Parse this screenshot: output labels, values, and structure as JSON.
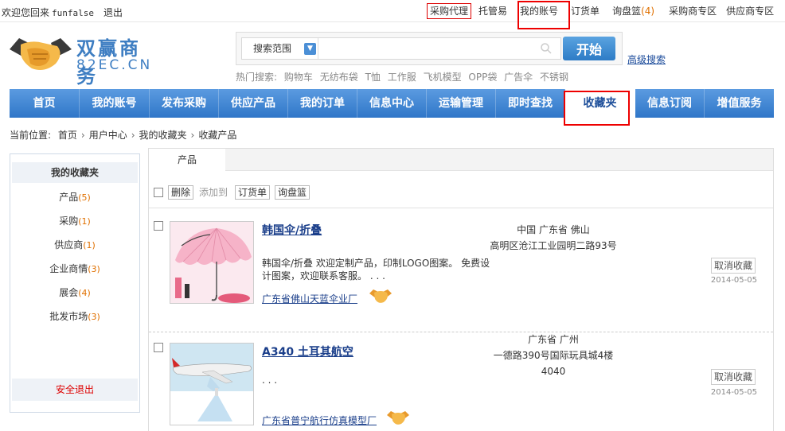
{
  "topbar": {
    "welcome": "欢迎您回来",
    "username": "funfalse",
    "logout": "退出",
    "links": [
      {
        "label": "采购代理",
        "count": ""
      },
      {
        "label": "托管易",
        "count": ""
      },
      {
        "label": "我的账号",
        "count": ""
      },
      {
        "label": "订货单",
        "count": ""
      },
      {
        "label": "询盘篮",
        "count": "(4)"
      },
      {
        "label": "采购商专区",
        "count": ""
      },
      {
        "label": "供应商专区",
        "count": ""
      }
    ]
  },
  "logo": {
    "cn": "双赢商务",
    "en": "82EC.CN"
  },
  "search": {
    "scope_label": "搜索范围",
    "input_value": "",
    "button_label": "开始",
    "advanced": "高级搜索",
    "hot_label": "热门搜索:",
    "hot_terms": [
      "购物车",
      "无纺布袋",
      "T恤",
      "工作服",
      "飞机模型",
      "OPP袋",
      "广告伞",
      "不锈钢"
    ]
  },
  "nav": [
    "首页",
    "我的账号",
    "发布采购",
    "供应产品",
    "我的订单",
    "信息中心",
    "运输管理",
    "即时查找",
    "收藏夹",
    "信息订阅",
    "增值服务"
  ],
  "breadcrumb": {
    "prefix": "当前位置:",
    "items": [
      "首页",
      "用户中心",
      "我的收藏夹",
      "收藏产品"
    ]
  },
  "sidebar": {
    "title": "我的收藏夹",
    "items": [
      {
        "label": "产品",
        "count": "(5)"
      },
      {
        "label": "采购",
        "count": "(1)"
      },
      {
        "label": "供应商",
        "count": "(1)"
      },
      {
        "label": "企业商情",
        "count": "(3)"
      },
      {
        "label": "展会",
        "count": "(4)"
      },
      {
        "label": "批发市场",
        "count": "(3)"
      }
    ],
    "logout": "安全退出"
  },
  "content": {
    "tab": "产品",
    "toolbar": {
      "delete": "删除",
      "add_to": "添加到",
      "order": "订货单",
      "inquiry": "询盘篮"
    },
    "items": [
      {
        "title": "韩国伞/折叠",
        "description": "韩国伞/折叠 欢迎定制产品，印制LOGO图案。 免费设计图案，欢迎联系客服。 . . .",
        "company": "广东省佛山天蓝伞业厂",
        "location1": "中国  广东省  佛山",
        "location2": "高明区沧江工业园明二路93号",
        "unfav": "取消收藏",
        "date": "2014-05-05"
      },
      {
        "title": "A340 土耳其航空",
        "description": ". . .",
        "company": "广东省普宁航行仿真模型厂",
        "location1": "广东省  广州",
        "location2": "一德路390号国际玩具城4楼4040",
        "unfav": "取消收藏",
        "date": "2014-05-05"
      }
    ]
  },
  "colors": {
    "accent": "#3e7ec2",
    "nav": "#2f76c8",
    "highlight": "#ee0000",
    "count": "#e07000"
  }
}
